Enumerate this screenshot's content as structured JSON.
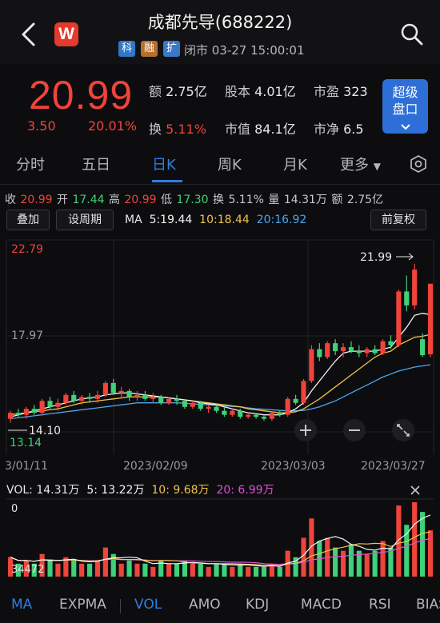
{
  "header": {
    "title": "成都先导(688222)",
    "tags": [
      "科",
      "融",
      "扩"
    ],
    "status": "闭市 03-27 15:00:01",
    "logo_letter": "W",
    "brand_color": "#e53b2c"
  },
  "quote": {
    "price": "20.99",
    "change": "3.50",
    "change_pct": "20.01%",
    "amount_label": "额",
    "amount": "2.75亿",
    "equity_label": "股本",
    "equity": "4.01亿",
    "pe_label": "市盈",
    "pe": "323",
    "turnover_label": "换",
    "turnover": "5.11%",
    "mcap_label": "市值",
    "mcap": "84.1亿",
    "pb_label": "市净",
    "pb": "6.5",
    "order_book_line1": "超级",
    "order_book_line2": "盘口"
  },
  "tabs": [
    "分时",
    "五日",
    "日K",
    "周K",
    "月K",
    "更多"
  ],
  "active_tab": "日K",
  "stats": {
    "close_label": "收",
    "close": "20.99",
    "open_label": "开",
    "open": "17.44",
    "high_label": "高",
    "high": "20.99",
    "low_label": "低",
    "low": "17.30",
    "turnover_label": "换",
    "turnover": "5.11%",
    "volume_label": "量",
    "volume": "14.31万",
    "amount_label": "额",
    "amount": "2.75亿"
  },
  "controls": {
    "overlay": "叠加",
    "period": "设周期",
    "adjust": "前复权",
    "ma_label": "MA",
    "ma5": "5:19.44",
    "ma10": "10:18.44",
    "ma20": "20:16.92"
  },
  "chart_labels": {
    "top_price": "22.79",
    "mid_price": "17.97",
    "low_price": "13.14",
    "high_marker": "21.99",
    "low_marker": "14.10",
    "dates": [
      "3/01/11",
      "2023/02/09",
      "2023/03/03",
      "2023/03/27"
    ]
  },
  "volume": {
    "legend_label": "VOL: 14.31万",
    "ma5": "5: 13.22万",
    "ma10": "10: 9.68万",
    "ma20": "20: 6.99万",
    "top_tick": "0",
    "bottom_tick": "34472"
  },
  "indicator_tabs": [
    "MA",
    "EXPMA",
    "VOL",
    "AMO",
    "KDJ",
    "MACD",
    "RSI",
    "BIAS"
  ],
  "colors": {
    "up": "#f0443a",
    "down": "#3fd17a",
    "ma5": "#f4f4f4",
    "ma10": "#f2c14e",
    "ma20": "#4aa8f0",
    "accent": "#2f7de1"
  },
  "chart_data": {
    "type": "candlestick",
    "ylim": [
      13.14,
      22.79
    ],
    "candles": [
      [
        14.2,
        14.6,
        14.0,
        14.5
      ],
      [
        14.5,
        14.7,
        14.3,
        14.4
      ],
      [
        14.4,
        14.8,
        14.2,
        14.7
      ],
      [
        14.7,
        14.9,
        14.4,
        14.5
      ],
      [
        14.5,
        15.2,
        14.4,
        15.1
      ],
      [
        15.1,
        15.3,
        14.7,
        14.8
      ],
      [
        14.8,
        15.2,
        14.6,
        15.0
      ],
      [
        15.0,
        15.5,
        14.9,
        15.4
      ],
      [
        15.4,
        15.6,
        15.0,
        15.1
      ],
      [
        15.1,
        15.4,
        14.9,
        15.3
      ],
      [
        15.3,
        15.5,
        15.0,
        15.2
      ],
      [
        15.2,
        15.6,
        15.0,
        15.4
      ],
      [
        15.4,
        16.1,
        15.3,
        16.0
      ],
      [
        16.0,
        16.2,
        15.4,
        15.5
      ],
      [
        15.5,
        15.8,
        15.2,
        15.6
      ],
      [
        15.6,
        15.7,
        15.1,
        15.3
      ],
      [
        15.3,
        15.6,
        15.1,
        15.4
      ],
      [
        15.4,
        15.6,
        15.1,
        15.2
      ],
      [
        15.2,
        15.5,
        15.0,
        15.3
      ],
      [
        15.3,
        15.4,
        14.9,
        15.0
      ],
      [
        15.0,
        15.3,
        14.9,
        15.2
      ],
      [
        15.2,
        15.4,
        14.9,
        15.1
      ],
      [
        15.1,
        15.2,
        14.7,
        14.8
      ],
      [
        14.8,
        15.1,
        14.7,
        15.0
      ],
      [
        15.0,
        15.1,
        14.6,
        14.7
      ],
      [
        14.7,
        14.9,
        14.5,
        14.8
      ],
      [
        14.8,
        14.9,
        14.5,
        14.6
      ],
      [
        14.6,
        14.8,
        14.3,
        14.4
      ],
      [
        14.4,
        14.7,
        14.3,
        14.6
      ],
      [
        14.6,
        14.7,
        14.2,
        14.3
      ],
      [
        14.3,
        14.5,
        14.2,
        14.4
      ],
      [
        14.4,
        14.5,
        14.2,
        14.3
      ],
      [
        14.3,
        14.4,
        14.1,
        14.2
      ],
      [
        14.2,
        14.6,
        14.1,
        14.5
      ],
      [
        14.5,
        14.6,
        14.3,
        14.4
      ],
      [
        14.4,
        15.3,
        14.3,
        15.2
      ],
      [
        15.2,
        15.4,
        14.9,
        15.0
      ],
      [
        15.0,
        16.2,
        14.9,
        16.1
      ],
      [
        16.1,
        17.9,
        16.0,
        17.7
      ],
      [
        17.7,
        18.0,
        17.1,
        17.3
      ],
      [
        17.3,
        18.1,
        17.2,
        18.0
      ],
      [
        18.0,
        18.2,
        17.4,
        17.6
      ],
      [
        17.6,
        18.0,
        17.3,
        17.8
      ],
      [
        17.8,
        18.1,
        17.5,
        17.6
      ],
      [
        17.6,
        17.9,
        17.3,
        17.5
      ],
      [
        17.5,
        17.8,
        17.3,
        17.7
      ],
      [
        17.7,
        17.9,
        17.4,
        17.5
      ],
      [
        17.5,
        18.2,
        17.4,
        18.1
      ],
      [
        18.1,
        18.4,
        17.7,
        17.9
      ],
      [
        17.9,
        20.7,
        17.8,
        20.6
      ],
      [
        20.6,
        21.4,
        19.6,
        19.9
      ],
      [
        19.9,
        21.99,
        19.7,
        21.7
      ],
      [
        18.2,
        18.5,
        17.3,
        17.4
      ],
      [
        17.44,
        20.99,
        17.3,
        20.99
      ]
    ],
    "ma5": [
      14.3,
      14.4,
      14.5,
      14.6,
      14.7,
      14.8,
      14.9,
      15.0,
      15.1,
      15.2,
      15.25,
      15.3,
      15.4,
      15.45,
      15.5,
      15.5,
      15.45,
      15.4,
      15.35,
      15.3,
      15.25,
      15.2,
      15.15,
      15.1,
      15.0,
      14.95,
      14.9,
      14.8,
      14.7,
      14.6,
      14.5,
      14.45,
      14.4,
      14.4,
      14.4,
      14.5,
      14.7,
      15.0,
      15.6,
      16.1,
      16.6,
      17.1,
      17.5,
      17.6,
      17.6,
      17.6,
      17.6,
      17.7,
      17.8,
      18.3,
      18.8,
      19.4,
      19.5,
      19.44
    ],
    "ma10": [
      14.4,
      14.45,
      14.5,
      14.55,
      14.6,
      14.65,
      14.7,
      14.8,
      14.9,
      15.0,
      15.05,
      15.1,
      15.15,
      15.2,
      15.25,
      15.3,
      15.3,
      15.3,
      15.3,
      15.3,
      15.25,
      15.2,
      15.15,
      15.1,
      15.05,
      15.0,
      14.95,
      14.9,
      14.85,
      14.8,
      14.7,
      14.65,
      14.6,
      14.55,
      14.5,
      14.5,
      14.55,
      14.7,
      14.95,
      15.2,
      15.5,
      15.8,
      16.1,
      16.4,
      16.7,
      17.0,
      17.3,
      17.5,
      17.6,
      17.9,
      18.1,
      18.3,
      18.35,
      18.44
    ],
    "ma20": [
      14.2,
      14.25,
      14.3,
      14.35,
      14.4,
      14.45,
      14.5,
      14.55,
      14.6,
      14.65,
      14.7,
      14.75,
      14.8,
      14.85,
      14.9,
      14.95,
      15.0,
      15.0,
      15.0,
      15.0,
      15.0,
      15.0,
      14.98,
      14.95,
      14.92,
      14.9,
      14.88,
      14.85,
      14.82,
      14.8,
      14.75,
      14.7,
      14.68,
      14.65,
      14.62,
      14.6,
      14.6,
      14.62,
      14.7,
      14.8,
      14.95,
      15.1,
      15.3,
      15.5,
      15.7,
      15.9,
      16.1,
      16.3,
      16.45,
      16.6,
      16.7,
      16.8,
      16.86,
      16.92
    ],
    "volume": [
      6,
      4,
      5,
      4,
      7,
      5,
      4,
      6,
      5,
      4,
      4,
      5,
      9,
      7,
      4,
      5,
      4,
      4,
      3,
      5,
      4,
      4,
      5,
      4,
      4,
      3,
      4,
      4,
      3,
      4,
      3,
      3,
      3,
      4,
      3,
      8,
      6,
      12,
      18,
      11,
      12,
      9,
      8,
      10,
      8,
      7,
      8,
      11,
      9,
      22,
      16,
      23,
      20,
      14.31
    ]
  }
}
